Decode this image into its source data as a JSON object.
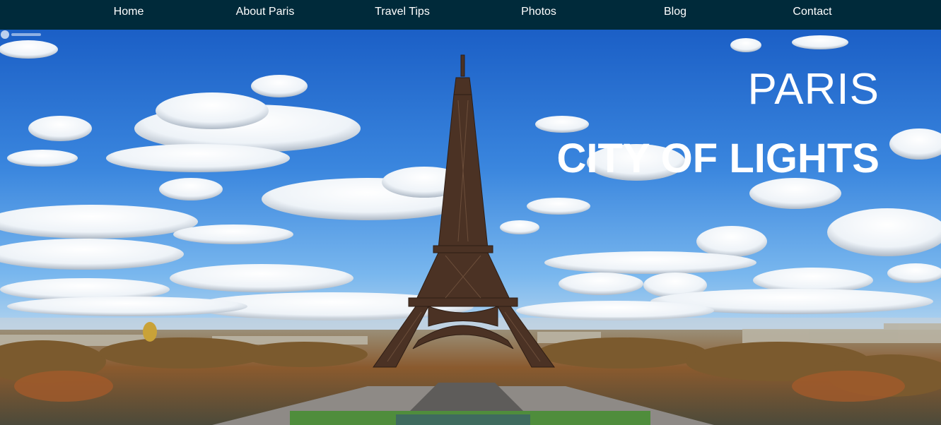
{
  "nav": {
    "items": [
      {
        "label": "Home"
      },
      {
        "label": "About Paris"
      },
      {
        "label": "Travel Tips"
      },
      {
        "label": "Photos"
      },
      {
        "label": "Blog"
      },
      {
        "label": "Contact"
      }
    ]
  },
  "hero": {
    "title": "PARIS",
    "subtitle": "CITY OF LIGHTS",
    "image": "eiffel-tower-skyline-photo"
  },
  "colors": {
    "nav_background": "#002a3a",
    "nav_text": "#ffffff",
    "hero_text": "#ffffff"
  }
}
